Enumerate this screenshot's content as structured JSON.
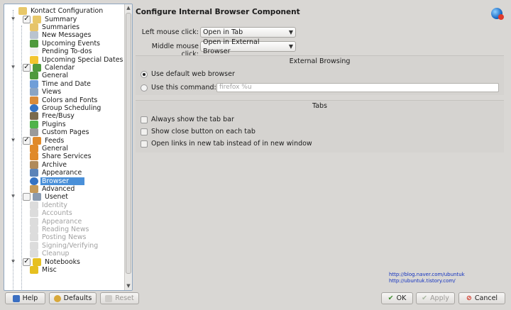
{
  "tree": [
    {
      "label": "Kontact Configuration",
      "depth": 0,
      "icon": "folder-icon",
      "color": "#e8c86a",
      "check": null
    },
    {
      "label": "Summary",
      "depth": 1,
      "icon": "summary-icon",
      "color": "#e8c86a",
      "check": true,
      "expander": "-"
    },
    {
      "label": "Summaries",
      "depth": 2,
      "icon": "summaries-icon",
      "color": "#e6c46a"
    },
    {
      "label": "New Messages",
      "depth": 2,
      "icon": "mail-icon",
      "color": "#b9c3cf"
    },
    {
      "label": "Upcoming Events",
      "depth": 2,
      "icon": "calendar-icon",
      "color": "#4f9a3d"
    },
    {
      "label": "Pending To-dos",
      "depth": 2,
      "icon": "todo-icon",
      "color": "#f0f0f0"
    },
    {
      "label": "Upcoming Special Dates",
      "depth": 2,
      "icon": "star-icon",
      "color": "#f2c530"
    },
    {
      "label": "Calendar",
      "depth": 1,
      "icon": "calendar-icon",
      "color": "#4f9a3d",
      "check": true,
      "expander": "-"
    },
    {
      "label": "General",
      "depth": 2,
      "icon": "calendar-icon",
      "color": "#4f9a3d"
    },
    {
      "label": "Time and Date",
      "depth": 2,
      "icon": "clock-icon",
      "color": "#6f9ed8"
    },
    {
      "label": "Views",
      "depth": 2,
      "icon": "views-icon",
      "color": "#8aa4c4"
    },
    {
      "label": "Colors and Fonts",
      "depth": 2,
      "icon": "palette-icon",
      "color": "#d98b3a"
    },
    {
      "label": "Group Scheduling",
      "depth": 2,
      "icon": "globe-icon",
      "color": "#3573c4"
    },
    {
      "label": "Free/Busy",
      "depth": 2,
      "icon": "freebusy-icon",
      "color": "#7a6b4e"
    },
    {
      "label": "Plugins",
      "depth": 2,
      "icon": "plugin-icon",
      "color": "#4fb34a"
    },
    {
      "label": "Custom Pages",
      "depth": 2,
      "icon": "pen-icon",
      "color": "#9a9a9a"
    },
    {
      "label": "Feeds",
      "depth": 1,
      "icon": "feeds-icon",
      "color": "#e08a2a",
      "check": true,
      "expander": "-"
    },
    {
      "label": "General",
      "depth": 2,
      "icon": "feeds-icon",
      "color": "#e08a2a"
    },
    {
      "label": "Share Services",
      "depth": 2,
      "icon": "share-icon",
      "color": "#e08a2a"
    },
    {
      "label": "Archive",
      "depth": 2,
      "icon": "archive-icon",
      "color": "#b08a5a"
    },
    {
      "label": "Appearance",
      "depth": 2,
      "icon": "appearance-icon",
      "color": "#5b83b8"
    },
    {
      "label": "Browser",
      "depth": 2,
      "icon": "globe-icon",
      "color": "#3573c4",
      "selected": true
    },
    {
      "label": "Advanced",
      "depth": 2,
      "icon": "advanced-icon",
      "color": "#c59a5a"
    },
    {
      "label": "Usenet",
      "depth": 1,
      "icon": "usenet-icon",
      "color": "#8a9bb0",
      "check": false,
      "expander": "-"
    },
    {
      "label": "Identity",
      "depth": 2,
      "icon": "identity-icon",
      "color": "#dcdcdc",
      "disabled": true
    },
    {
      "label": "Accounts",
      "depth": 2,
      "icon": "accounts-icon",
      "color": "#dcdcdc",
      "disabled": true
    },
    {
      "label": "Appearance",
      "depth": 2,
      "icon": "appearance-icon",
      "color": "#dcdcdc",
      "disabled": true
    },
    {
      "label": "Reading News",
      "depth": 2,
      "icon": "reading-icon",
      "color": "#dcdcdc",
      "disabled": true
    },
    {
      "label": "Posting News",
      "depth": 2,
      "icon": "posting-icon",
      "color": "#dcdcdc",
      "disabled": true
    },
    {
      "label": "Signing/Verifying",
      "depth": 2,
      "icon": "lock-icon",
      "color": "#dcdcdc",
      "disabled": true
    },
    {
      "label": "Cleanup",
      "depth": 2,
      "icon": "cleanup-icon",
      "color": "#dcdcdc",
      "disabled": true
    },
    {
      "label": "Notebooks",
      "depth": 1,
      "icon": "notebook-icon",
      "color": "#e6c020",
      "check": true,
      "expander": "-"
    },
    {
      "label": "Misc",
      "depth": 2,
      "icon": "notebook-icon",
      "color": "#e6c020"
    }
  ],
  "page": {
    "title": "Configure Internal Browser Component",
    "left_click_label": "Left mouse click:",
    "left_click_value": "Open in Tab",
    "middle_click_label": "Middle mouse click:",
    "middle_click_value": "Open in External Browser"
  },
  "external": {
    "title": "External Browsing",
    "opt_default": "Use default web browser",
    "opt_command": "Use this command:",
    "command_placeholder": "firefox %u"
  },
  "tabs": {
    "title": "Tabs",
    "always_show": "Always show the tab bar",
    "close_button": "Show close button on each tab",
    "new_tab": "Open links in new tab instead of in new window"
  },
  "watermark": {
    "line1": "http://blog.naver.com/ubuntuk",
    "line2": "http://ubuntuk.tistory.com/"
  },
  "buttons": {
    "help": "Help",
    "defaults": "Defaults",
    "reset": "Reset",
    "ok": "OK",
    "apply": "Apply",
    "cancel": "Cancel"
  }
}
